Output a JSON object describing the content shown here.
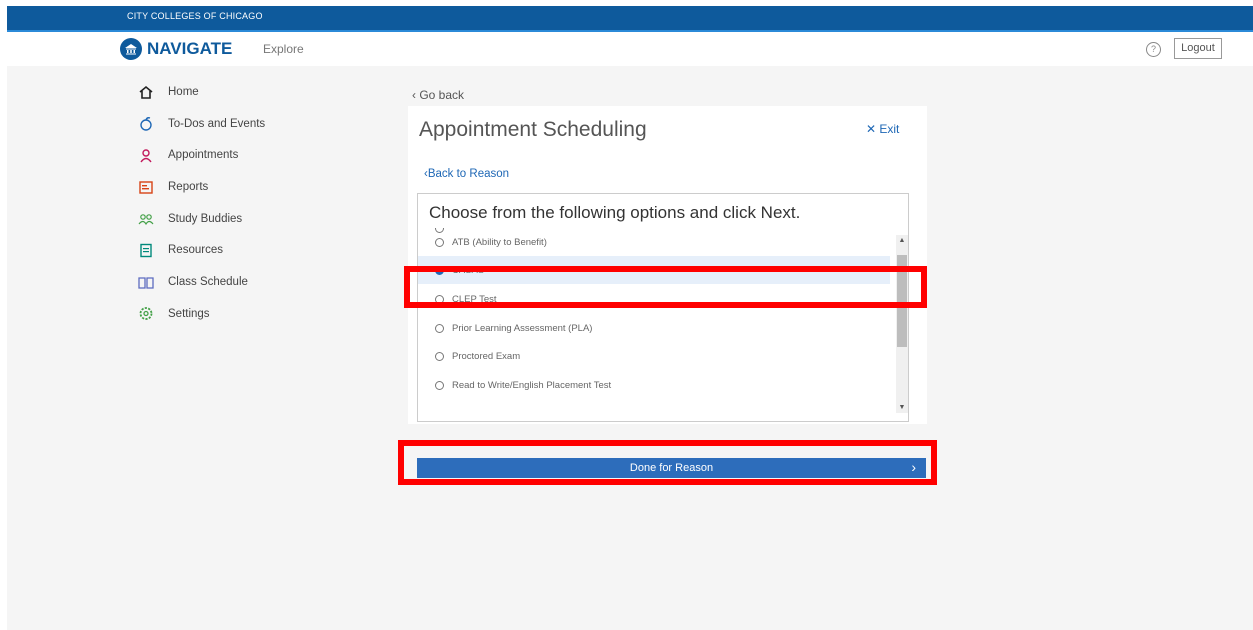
{
  "topbar": {
    "org": "CITY COLLEGES OF CHICAGO"
  },
  "header": {
    "logo": "NAVIGATE",
    "explore": "Explore",
    "help_icon": "?",
    "logout": "Logout"
  },
  "nav": [
    {
      "label": "Home",
      "icon": "home-icon",
      "color": "#222222"
    },
    {
      "label": "To-Dos and Events",
      "icon": "apple-icon",
      "color": "#1e67b5"
    },
    {
      "label": "Appointments",
      "icon": "person-icon",
      "color": "#c2185b"
    },
    {
      "label": "Reports",
      "icon": "report-icon",
      "color": "#d84315"
    },
    {
      "label": "Study Buddies",
      "icon": "people-icon",
      "color": "#43a047"
    },
    {
      "label": "Resources",
      "icon": "document-icon",
      "color": "#00897b"
    },
    {
      "label": "Class Schedule",
      "icon": "book-icon",
      "color": "#5c6bc0"
    },
    {
      "label": "Settings",
      "icon": "gear-icon",
      "color": "#43a047"
    }
  ],
  "main": {
    "go_back": "Go back",
    "title": "Appointment Scheduling",
    "exit": "Exit",
    "back_to_reason": "Back to Reason",
    "instruction": "Choose from the following options and click Next.",
    "options": [
      {
        "label": "ATB (Ability to Benefit)",
        "selected": false
      },
      {
        "label": "CASAS",
        "selected": true
      },
      {
        "label": "CLEP Test",
        "selected": false
      },
      {
        "label": "Prior Learning Assessment (PLA)",
        "selected": false
      },
      {
        "label": "Proctored Exam",
        "selected": false
      },
      {
        "label": "Read to Write/English Placement Test",
        "selected": false
      }
    ],
    "done_button": "Done for Reason"
  },
  "colors": {
    "brand": "#0e5a9c",
    "accent": "#1e67b5",
    "highlight": "#ff0000",
    "button": "#2d6dbb"
  }
}
